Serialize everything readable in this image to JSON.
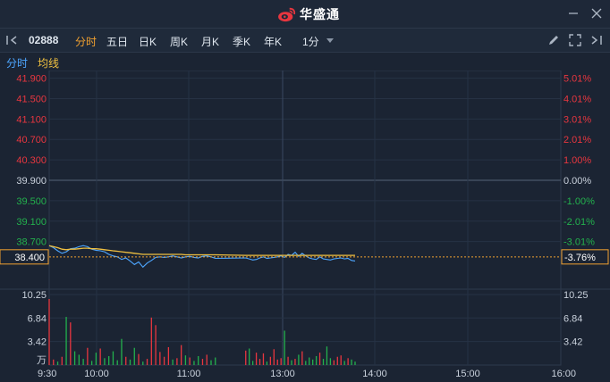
{
  "app": {
    "brand_name": "华盛通"
  },
  "toolbar": {
    "code": "02888",
    "tabs": [
      "分时",
      "五日",
      "日K",
      "周K",
      "月K",
      "季K",
      "年K"
    ],
    "active_tab": "分时",
    "period": "1分"
  },
  "legend": {
    "line1": "分时",
    "line2": "均线"
  },
  "colors": {
    "up": "#e8363f",
    "down": "#23b14d",
    "flat": "#c9d1dc",
    "price": "#4da6ff",
    "avg": "#f0c040",
    "accent": "#f0a030"
  },
  "chart_data": {
    "type": "line",
    "prev_close": 39.9,
    "price_ticks": [
      "41.900",
      "41.500",
      "41.100",
      "40.700",
      "40.300",
      "39.900",
      "39.500",
      "39.100",
      "38.700"
    ],
    "pct_ticks": [
      "5.01%",
      "4.01%",
      "3.01%",
      "2.01%",
      "1.00%",
      "0.00%",
      "-1.00%",
      "-2.01%",
      "-3.01%"
    ],
    "current_price": "38.400",
    "current_pct": "-3.76%",
    "time_ticks": [
      "9:30",
      "10:00",
      "11:00",
      "13:00",
      "14:00",
      "15:00",
      "16:00"
    ],
    "volume_ticks": [
      "10.25",
      "6.84",
      "3.42"
    ],
    "volume_unit": "万",
    "ylim": [
      37.89,
      41.91
    ],
    "series": [
      {
        "name": "分时",
        "color": "#4da6ff",
        "values": [
          38.62,
          38.58,
          38.52,
          38.47,
          38.5,
          38.56,
          38.57,
          38.6,
          38.62,
          38.6,
          38.55,
          38.53,
          38.52,
          38.5,
          38.45,
          38.42,
          38.4,
          38.35,
          38.38,
          38.32,
          38.25,
          38.3,
          38.2,
          38.28,
          38.33,
          38.39,
          38.4,
          38.39,
          38.4,
          38.42,
          38.4,
          38.38,
          38.4,
          38.41,
          38.39,
          38.38,
          38.41,
          38.42,
          38.4,
          38.37,
          38.38,
          38.36,
          38.34,
          38.35,
          38.38,
          38.4,
          38.37,
          38.38,
          38.39,
          38.4,
          38.42,
          38.39,
          38.45,
          38.43,
          38.49,
          38.41,
          38.47,
          38.42,
          38.38,
          38.36,
          38.35,
          38.4,
          38.36,
          38.35,
          38.34,
          38.36,
          38.37,
          38.38,
          38.36,
          38.37,
          38.33,
          38.32
        ]
      },
      {
        "name": "均线",
        "color": "#f0c040",
        "values": [
          38.62,
          38.6,
          38.58,
          38.55,
          38.54,
          38.55,
          38.55,
          38.56,
          38.57,
          38.57,
          38.56,
          38.56,
          38.55,
          38.54,
          38.53,
          38.52,
          38.51,
          38.5,
          38.49,
          38.48,
          38.47,
          38.46,
          38.45,
          38.45,
          38.45,
          38.45,
          38.45,
          38.45,
          38.45,
          38.45,
          38.45,
          38.45,
          38.44,
          38.44,
          38.44,
          38.44,
          38.44,
          38.44,
          38.44,
          38.44,
          38.43,
          38.43,
          38.43,
          38.43,
          38.43,
          38.43,
          38.43,
          38.43,
          38.43,
          38.43,
          38.43,
          38.43,
          38.43,
          38.43,
          38.43,
          38.43,
          38.43,
          38.43,
          38.43,
          38.43,
          38.43,
          38.43,
          38.43,
          38.43,
          38.43,
          38.43,
          38.43,
          38.43,
          38.43,
          38.43,
          38.43,
          38.43
        ]
      }
    ],
    "volume": {
      "max": 10.25,
      "values": [
        9.6,
        0.8,
        0.5,
        1.2,
        7.0,
        6.2,
        2.0,
        1.5,
        0.9,
        2.5,
        0.6,
        1.8,
        2.4,
        1.0,
        1.3,
        2.0,
        0.7,
        3.8,
        1.2,
        0.8,
        2.5,
        1.6,
        0.5,
        0.9,
        6.9,
        5.8,
        1.9,
        1.2,
        2.6,
        0.8,
        1.0,
        2.9,
        1.4,
        1.1,
        0.6,
        1.3,
        0.9,
        1.5,
        0.7,
        1.1,
        2.1,
        2.4,
        0.6,
        1.8,
        0.9,
        1.7,
        0.5,
        1.2,
        2.3,
        0.8,
        1.0,
        5.0,
        1.2,
        0.7,
        0.9,
        1.5,
        2.0,
        0.6,
        1.1,
        0.8,
        1.3,
        1.8,
        0.9,
        2.7,
        1.0,
        0.7,
        1.2,
        1.4,
        0.6,
        1.0,
        0.8,
        0.5
      ],
      "dirs": [
        "u",
        "u",
        "d",
        "u",
        "d",
        "u",
        "d",
        "d",
        "d",
        "u",
        "d",
        "d",
        "u",
        "d",
        "d",
        "d",
        "d",
        "d",
        "u",
        "d",
        "d",
        "u",
        "d",
        "u",
        "u",
        "u",
        "u",
        "u",
        "u",
        "d",
        "u",
        "u",
        "d",
        "u",
        "d",
        "d",
        "u",
        "u",
        "d",
        "d",
        "u",
        "d",
        "d",
        "u",
        "u",
        "u",
        "d",
        "u",
        "u",
        "u",
        "u",
        "d",
        "u",
        "d",
        "u",
        "d",
        "u",
        "d",
        "d",
        "d",
        "d",
        "u",
        "d",
        "d",
        "d",
        "u",
        "u",
        "u",
        "d",
        "u",
        "d",
        "d"
      ]
    }
  }
}
